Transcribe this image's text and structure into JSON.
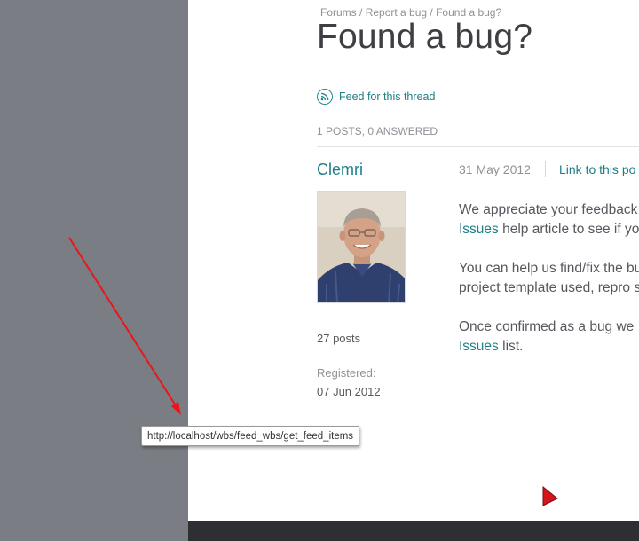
{
  "breadcrumb": {
    "forums": "Forums",
    "sep1": " / ",
    "report": "Report a bug",
    "sep2": " / ",
    "current": "Found a bug?"
  },
  "thread": {
    "title": "Found a bug?",
    "feed_label": "Feed for this thread",
    "post_count": "1 POSTS, 0 ANSWERED"
  },
  "post": {
    "author": {
      "name": "Clemri",
      "posts": "27 posts",
      "registered_label": "Registered:",
      "registered_date": "07 Jun 2012"
    },
    "date": "31 May 2012",
    "permalink": "Link to this po",
    "body": {
      "line1": "We appreciate your feedback",
      "line2_link": "Issues",
      "line2_text": " help article to see if yo",
      "line3": "You can help us find/fix the bu",
      "line4": "project template used, repro s",
      "line5": "Once confirmed as a bug we ",
      "line6_link": "Issues",
      "line6_text": " list."
    }
  },
  "tooltip": {
    "url": "http://localhost/wbs/feed_wbs/get_feed_items"
  },
  "colors": {
    "accent": "#1e7f86",
    "gutter": "#7a7d84",
    "footer": "#2e2f33",
    "annotation": "#e8161b"
  },
  "icons": {
    "feed": "rss-icon",
    "cursor": "mouse-cursor-icon"
  }
}
